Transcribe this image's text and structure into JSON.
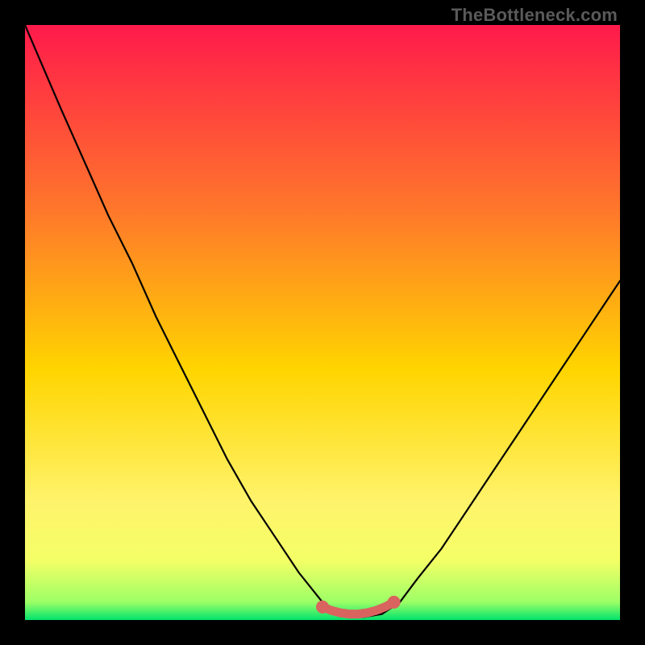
{
  "watermark": "TheBottleneck.com",
  "colors": {
    "frame": "#000000",
    "gradient_top": "#ff1a4b",
    "gradient_mid_upper": "#ff7a2a",
    "gradient_mid": "#ffd500",
    "gradient_lower": "#fff36b",
    "gradient_bottom": "#00e36c",
    "curve": "#000000",
    "marker_fill": "#d9645f",
    "marker_stroke": "#d9645f"
  },
  "chart_data": {
    "type": "line",
    "title": "",
    "xlabel": "",
    "ylabel": "",
    "xlim": [
      0,
      100
    ],
    "ylim": [
      0,
      100
    ],
    "grid": false,
    "legend": false,
    "series": [
      {
        "name": "bottleneck-curve",
        "x": [
          0,
          3,
          6,
          10,
          14,
          18,
          22,
          26,
          30,
          34,
          38,
          42,
          46,
          50,
          53,
          55,
          57,
          60,
          63,
          66,
          70,
          74,
          78,
          82,
          86,
          90,
          94,
          98,
          100
        ],
        "y": [
          100,
          93,
          86,
          77,
          68,
          60,
          51,
          43,
          35,
          27,
          20,
          14,
          8,
          3,
          1,
          0.5,
          0.5,
          1,
          3,
          7,
          12,
          18,
          24,
          30,
          36,
          42,
          48,
          54,
          57
        ]
      }
    ],
    "markers": {
      "name": "bottom-flat-segment",
      "x": [
        50,
        51.5,
        53,
        54.5,
        56,
        57.5,
        59,
        60.5,
        62
      ],
      "y": [
        2.2,
        1.6,
        1.2,
        1.0,
        1.0,
        1.2,
        1.6,
        2.2,
        3.0
      ]
    }
  }
}
